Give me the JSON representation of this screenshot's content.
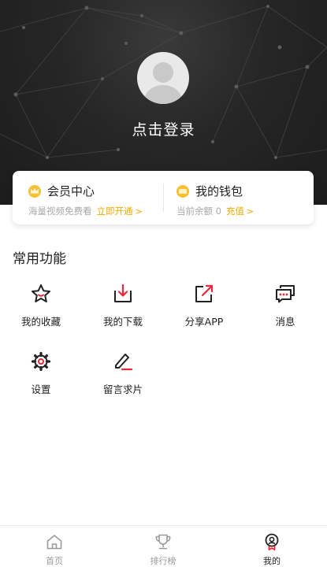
{
  "profile": {
    "login_label": "点击登录"
  },
  "membership": {
    "title": "会员中心",
    "subtitle": "海量视频免费看",
    "action_label": "立即开通",
    "icon": "crown-coin-icon"
  },
  "wallet": {
    "title": "我的钱包",
    "subtitle": "当前余额 0",
    "action_label": "充值",
    "icon": "wallet-coin-icon"
  },
  "features": {
    "section_title": "常用功能",
    "items": [
      {
        "label": "我的收藏",
        "icon": "star-icon"
      },
      {
        "label": "我的下载",
        "icon": "download-icon"
      },
      {
        "label": "分享APP",
        "icon": "share-icon"
      },
      {
        "label": "消息",
        "icon": "message-icon"
      },
      {
        "label": "设置",
        "icon": "gear-icon"
      },
      {
        "label": "留言求片",
        "icon": "edit-icon"
      }
    ]
  },
  "tabbar": {
    "tabs": [
      {
        "label": "首页",
        "icon": "home-icon",
        "active": false
      },
      {
        "label": "排行榜",
        "icon": "trophy-icon",
        "active": false
      },
      {
        "label": "我的",
        "icon": "profile-badge-icon",
        "active": true
      }
    ]
  },
  "colors": {
    "header_bg": "#262626",
    "accent_gold": "#f2a900",
    "icon_red": "#e8283c",
    "text_dark": "#222222",
    "text_gray": "#a8a8a8"
  }
}
